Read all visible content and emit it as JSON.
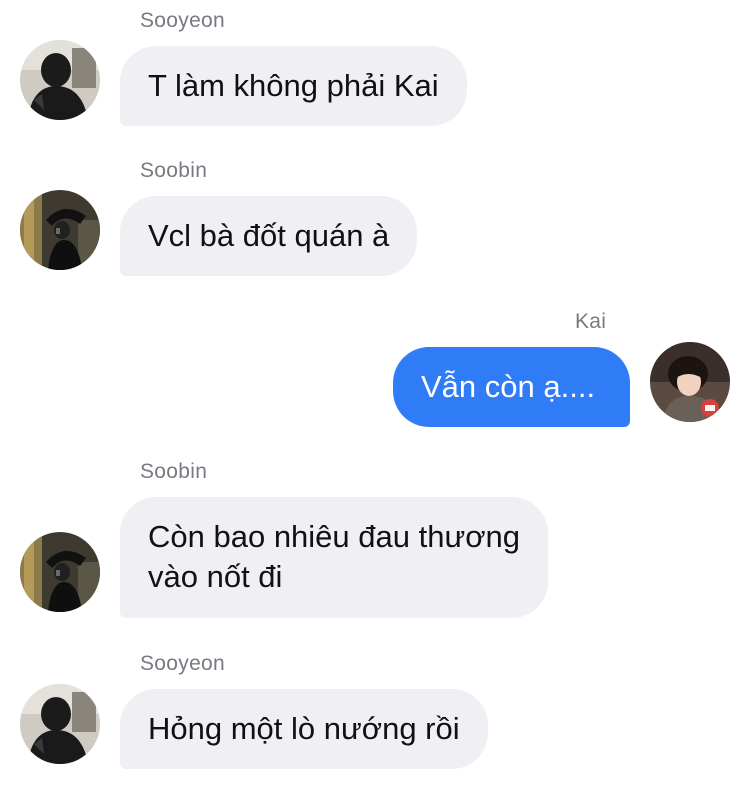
{
  "messages": [
    {
      "sender": "Sooyeon",
      "text": "T làm không phải Kai",
      "direction": "incoming",
      "avatar": "sooyeon-avatar"
    },
    {
      "sender": "Soobin",
      "text": "Vcl bà đốt quán à",
      "direction": "incoming",
      "avatar": "soobin-avatar"
    },
    {
      "sender": "Kai",
      "text": "Vẫn còn ạ....",
      "direction": "outgoing",
      "avatar": "kai-avatar"
    },
    {
      "sender": "Soobin",
      "text": "Còn bao nhiêu đau thương\nvào nốt đi",
      "direction": "incoming",
      "avatar": "soobin-avatar"
    },
    {
      "sender": "Sooyeon",
      "text": "Hỏng một lò nướng rồi",
      "direction": "incoming",
      "avatar": "sooyeon-avatar"
    }
  ],
  "colors": {
    "incoming_bubble": "#f0f0f4",
    "outgoing_bubble": "#2f7cf6",
    "sender_name": "#777a80"
  }
}
